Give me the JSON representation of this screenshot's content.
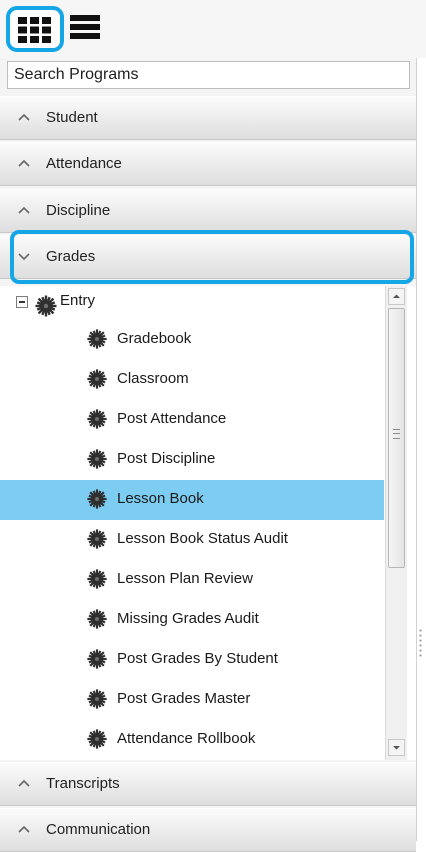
{
  "toolbar": {
    "grid_icon": "grid-icon",
    "list_icon": "list-icon"
  },
  "search": {
    "placeholder": "Search Programs"
  },
  "sections_top": [
    {
      "label": "Student",
      "state": "collapsed"
    },
    {
      "label": "Attendance",
      "state": "collapsed"
    },
    {
      "label": "Discipline",
      "state": "collapsed"
    },
    {
      "label": "Grades",
      "state": "expanded"
    }
  ],
  "tree": {
    "folder": {
      "label": "Entry",
      "icon": "cog-icon"
    },
    "items": [
      {
        "label": "Gradebook",
        "selected": false
      },
      {
        "label": "Classroom",
        "selected": false
      },
      {
        "label": "Post Attendance",
        "selected": false
      },
      {
        "label": "Post Discipline",
        "selected": false
      },
      {
        "label": "Lesson Book",
        "selected": true
      },
      {
        "label": "Lesson Book Status Audit",
        "selected": false
      },
      {
        "label": "Lesson Plan Review",
        "selected": false
      },
      {
        "label": "Missing Grades Audit",
        "selected": false
      },
      {
        "label": "Post Grades By Student",
        "selected": false
      },
      {
        "label": "Post Grades Master",
        "selected": false
      },
      {
        "label": "Attendance Rollbook",
        "selected": false
      }
    ]
  },
  "sections_bottom": [
    {
      "label": "Transcripts",
      "state": "collapsed"
    },
    {
      "label": "Communication",
      "state": "collapsed"
    }
  ],
  "colors": {
    "accent": "#15a6e6",
    "selection": "#7ccdf1",
    "cog": "#2f2f2f"
  }
}
